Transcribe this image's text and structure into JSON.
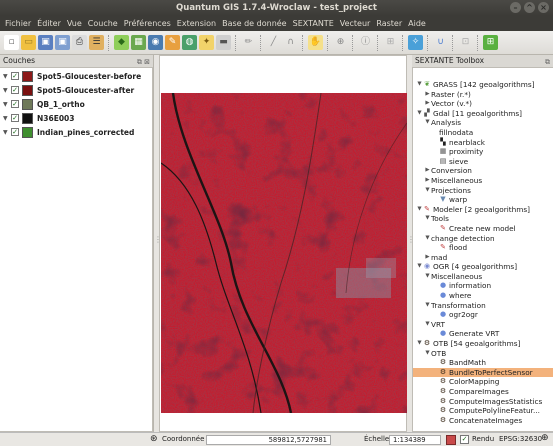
{
  "window": {
    "title": "Quantum GIS 1.7.4-Wroclaw - test_project"
  },
  "menubar": [
    {
      "label": "Fichier",
      "u": "F"
    },
    {
      "label": "Éditer",
      "u": "É"
    },
    {
      "label": "Vue",
      "u": "V"
    },
    {
      "label": "Couche",
      "u": "C"
    },
    {
      "label": "Préférences",
      "u": "P"
    },
    {
      "label": "Extension",
      "u": "E"
    },
    {
      "label": "Base de donnée",
      "u": "B"
    },
    {
      "label": "SEXTANTE",
      "u": ""
    },
    {
      "label": "Vecteur",
      "u": "V"
    },
    {
      "label": "Raster",
      "u": "R"
    },
    {
      "label": "Aide",
      "u": "A"
    }
  ],
  "toolbar": {
    "icons": [
      "new-project-icon",
      "open-project-icon",
      "save-project-icon",
      "save-as-icon",
      "print-composer-icon",
      "composer-manager-icon",
      "sep",
      "add-vector-layer-icon",
      "add-raster-layer-icon",
      "add-postgis-layer-icon",
      "add-spatialite-layer-icon",
      "add-wms-layer-icon",
      "new-shapefile-icon",
      "remove-layer-icon",
      "sep",
      "toggle-editing-icon",
      "sep",
      "capture-point-icon",
      "capture-line-icon",
      "sep",
      "pan-icon",
      "sep",
      "zoom-in-icon",
      "sep",
      "identify-icon",
      "sep",
      "measure-icon",
      "sep",
      "map-tips-icon",
      "sep",
      "digitize-node-icon",
      "sep",
      "gps-icon",
      "sep",
      "python-console-icon"
    ]
  },
  "layers_panel": {
    "title": "Couches",
    "layers": [
      {
        "name": "Spot5-Gloucester-before",
        "checked": true,
        "swatch": "#8c1a1a"
      },
      {
        "name": "Spot5-Gloucester-after",
        "checked": true,
        "swatch": "#7a1010"
      },
      {
        "name": "QB_1_ortho",
        "checked": true,
        "swatch": "#6f7a5a"
      },
      {
        "name": "N36E003",
        "checked": true,
        "swatch": "#111111"
      },
      {
        "name": "Indian_pines_corrected",
        "checked": true,
        "swatch": "#3f8f2f"
      }
    ]
  },
  "toolbox": {
    "title": "SEXTANTE Toolbox",
    "tree": [
      {
        "level": 0,
        "tri": "open",
        "icon": "grass-icon",
        "label": "GRASS [142 geoalgorithms]"
      },
      {
        "level": 1,
        "tri": "closed",
        "icon": "",
        "label": "Raster (r.*)"
      },
      {
        "level": 1,
        "tri": "closed",
        "icon": "",
        "label": "Vector (v.*)"
      },
      {
        "level": 0,
        "tri": "open",
        "icon": "gdal-icon",
        "label": "Gdal [11 geoalgorithms]"
      },
      {
        "level": 1,
        "tri": "open",
        "icon": "",
        "label": "Analysis"
      },
      {
        "level": 2,
        "tri": "",
        "icon": "",
        "label": "fillnodata"
      },
      {
        "level": 2,
        "tri": "",
        "icon": "nearblack-icon",
        "label": "nearblack"
      },
      {
        "level": 2,
        "tri": "",
        "icon": "proximity-icon",
        "label": "proximity"
      },
      {
        "level": 2,
        "tri": "",
        "icon": "sieve-icon",
        "label": "sieve"
      },
      {
        "level": 1,
        "tri": "closed",
        "icon": "",
        "label": "Conversion"
      },
      {
        "level": 1,
        "tri": "closed",
        "icon": "",
        "label": "Miscellaneous"
      },
      {
        "level": 1,
        "tri": "open",
        "icon": "",
        "label": "Projections"
      },
      {
        "level": 2,
        "tri": "",
        "icon": "warp-icon",
        "label": "warp"
      },
      {
        "level": 0,
        "tri": "open",
        "icon": "modeler-icon",
        "label": "Modeler [2 geoalgorithms]"
      },
      {
        "level": 1,
        "tri": "open",
        "icon": "",
        "label": "Tools"
      },
      {
        "level": 2,
        "tri": "",
        "icon": "model-icon",
        "label": "Create new model"
      },
      {
        "level": 1,
        "tri": "open",
        "icon": "",
        "label": "change detection"
      },
      {
        "level": 2,
        "tri": "",
        "icon": "model-icon",
        "label": "flood"
      },
      {
        "level": 1,
        "tri": "closed",
        "icon": "",
        "label": "mad"
      },
      {
        "level": 0,
        "tri": "open",
        "icon": "ogr-icon",
        "label": "OGR [4 geoalgorithms]"
      },
      {
        "level": 1,
        "tri": "open",
        "icon": "",
        "label": "Miscellaneous"
      },
      {
        "level": 2,
        "tri": "",
        "icon": "ogr-dot-icon",
        "label": "information"
      },
      {
        "level": 2,
        "tri": "",
        "icon": "ogr-dot-icon",
        "label": "where"
      },
      {
        "level": 1,
        "tri": "open",
        "icon": "",
        "label": "Transformation"
      },
      {
        "level": 2,
        "tri": "",
        "icon": "ogr-dot-icon",
        "label": "ogr2ogr"
      },
      {
        "level": 1,
        "tri": "open",
        "icon": "",
        "label": "VRT"
      },
      {
        "level": 2,
        "tri": "",
        "icon": "ogr-dot-icon",
        "label": "Generate VRT"
      },
      {
        "level": 0,
        "tri": "open",
        "icon": "otb-icon",
        "label": "OTB [54 geoalgorithms]"
      },
      {
        "level": 1,
        "tri": "open",
        "icon": "",
        "label": "OTB"
      },
      {
        "level": 2,
        "tri": "",
        "icon": "otb-icon",
        "label": "BandMath"
      },
      {
        "level": 2,
        "tri": "",
        "icon": "otb-icon",
        "label": "BundleToPerfectSensor",
        "selected": true
      },
      {
        "level": 2,
        "tri": "",
        "icon": "otb-icon",
        "label": "ColorMapping"
      },
      {
        "level": 2,
        "tri": "",
        "icon": "otb-icon",
        "label": "CompareImages"
      },
      {
        "level": 2,
        "tri": "",
        "icon": "otb-icon",
        "label": "ComputeImagesStatistics"
      },
      {
        "level": 2,
        "tri": "",
        "icon": "otb-icon",
        "label": "ComputePolylineFeatur..."
      },
      {
        "level": 2,
        "tri": "",
        "icon": "otb-icon",
        "label": "ConcatenateImages"
      }
    ]
  },
  "statusbar": {
    "coord_label": "Coordonnée :",
    "coord_value": "589812,5727981",
    "scale_label": "Échelle",
    "scale_value": "1:134389",
    "render_label": "Rendu",
    "render_checked": true,
    "crs": "EPSG:32630"
  },
  "colors": {
    "selection": "#f3b27c",
    "map_red": "#c0182a"
  }
}
